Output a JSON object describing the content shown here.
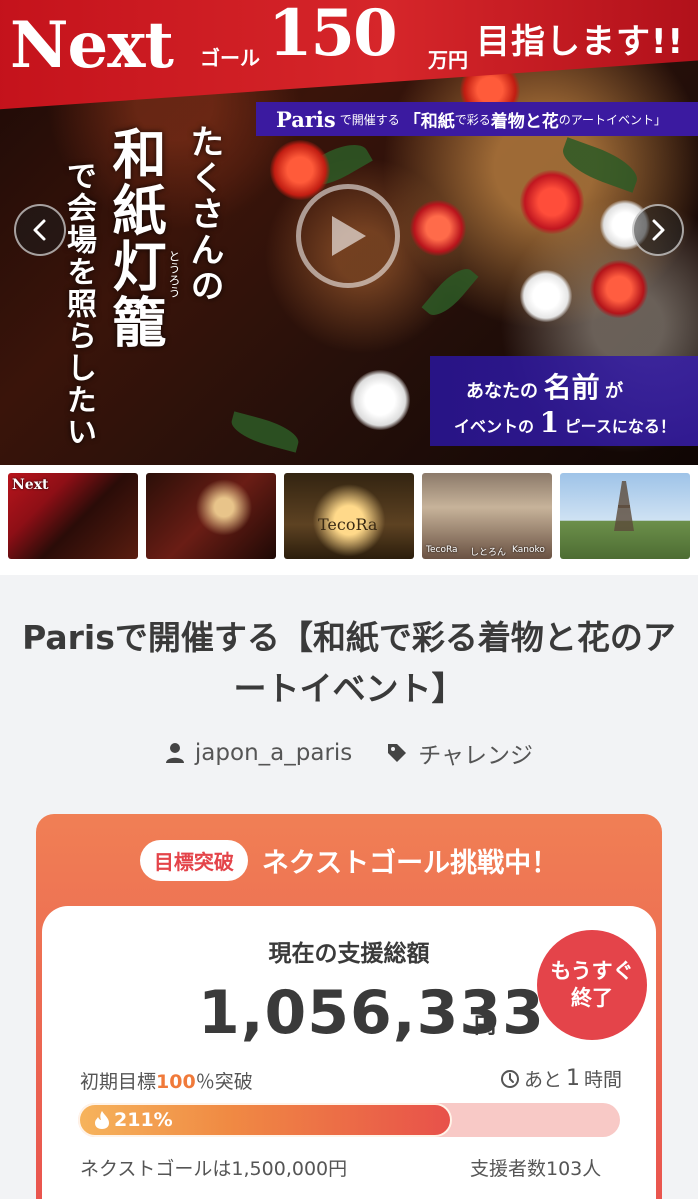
{
  "hero": {
    "banner_next": "Next",
    "banner_goal": "ゴール",
    "banner_amount": "150",
    "banner_unit": "万円",
    "banner_tail": "目指します!!",
    "event_strip_a": "Paris",
    "event_strip_b": "で開催する",
    "event_strip_c": "「和紙",
    "event_strip_d": "で彩る",
    "event_strip_e": "着物と花",
    "event_strip_f": "のアートイベント」",
    "vertical_1": "たくさんの",
    "vertical_2": "和紙灯籠",
    "vertical_ruby": "とうろう",
    "vertical_3": "で会場を照らしたい",
    "name_line_1a": "あなたの",
    "name_line_1b": "名前",
    "name_line_1c": "が",
    "name_line_2a": "イベントの",
    "name_line_2b": "1",
    "name_line_2c": "ピースになる！"
  },
  "thumbnails": {
    "t4_names": [
      "TecoRa",
      "しとろん",
      "Kanoko"
    ],
    "t3_text": "TecoRa"
  },
  "project": {
    "title": "Parisで開催する【和紙で彩る着物と花のアートイベント】",
    "author": "japon_a_paris",
    "category": "チャレンジ"
  },
  "funding": {
    "badge": "目標突破",
    "header": "ネクストゴール挑戦中！",
    "total_label": "現在の支援総額",
    "total_amount": "1,056,333",
    "currency": "円",
    "soon_line1": "もうすぐ",
    "soon_line2": "終了",
    "initial_prefix": "初期目標",
    "initial_pct": "100",
    "initial_suffix": "％突破",
    "remaining_prefix": "あと",
    "remaining_num": "1",
    "remaining_unit": "時間",
    "progress_label": "211%",
    "progress_fraction": 0.69,
    "next_goal": "ネクストゴールは1,500,000円",
    "supporters": "支援者数103人"
  },
  "colors": {
    "accent_red": "#e4444a",
    "accent_orange": "#f07a3a",
    "banner_red": "#c4121b",
    "banner_purple": "#3b1aa0"
  },
  "icons": {
    "prev": "chevron-left-icon",
    "next": "chevron-right-icon",
    "play": "play-icon",
    "user": "user-icon",
    "tag": "tag-icon",
    "clock": "clock-icon",
    "flame": "flame-icon"
  }
}
